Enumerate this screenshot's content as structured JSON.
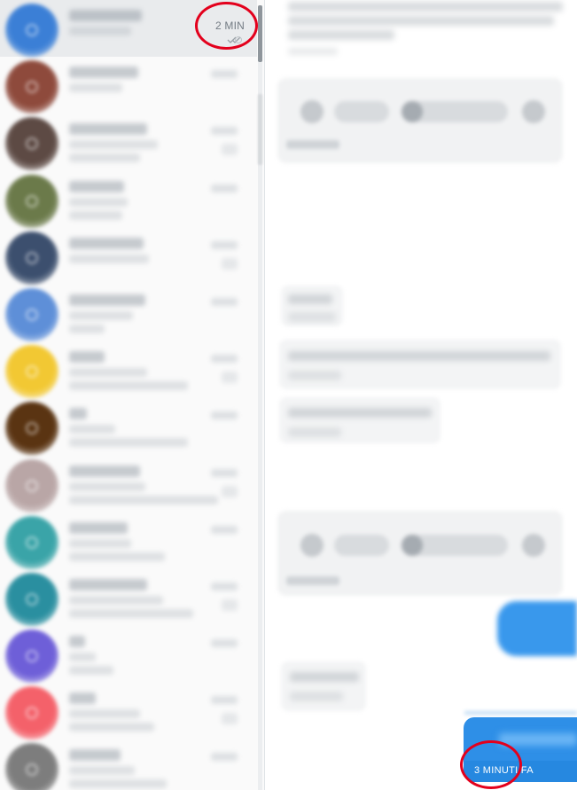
{
  "sidebar": {
    "active_conversation": {
      "time": "2 MIN",
      "status_icon": "double-check-icon"
    },
    "avatar_colors": [
      "#3b7fd6",
      "#8e4a3c",
      "#5d4a44",
      "#6b7a4a",
      "#3c4f6e",
      "#5e8fd8",
      "#f2c833",
      "#5a3412",
      "#b9a6a6",
      "#3aa4a8",
      "#2a8fa0",
      "#6e5fd8",
      "#f4616a",
      "#7d7d7d"
    ]
  },
  "chat": {
    "last_message": {
      "time": "3 MINUTI FA"
    }
  },
  "colors": {
    "accent": "#2e8fe7",
    "annotation": "#e3001c"
  }
}
